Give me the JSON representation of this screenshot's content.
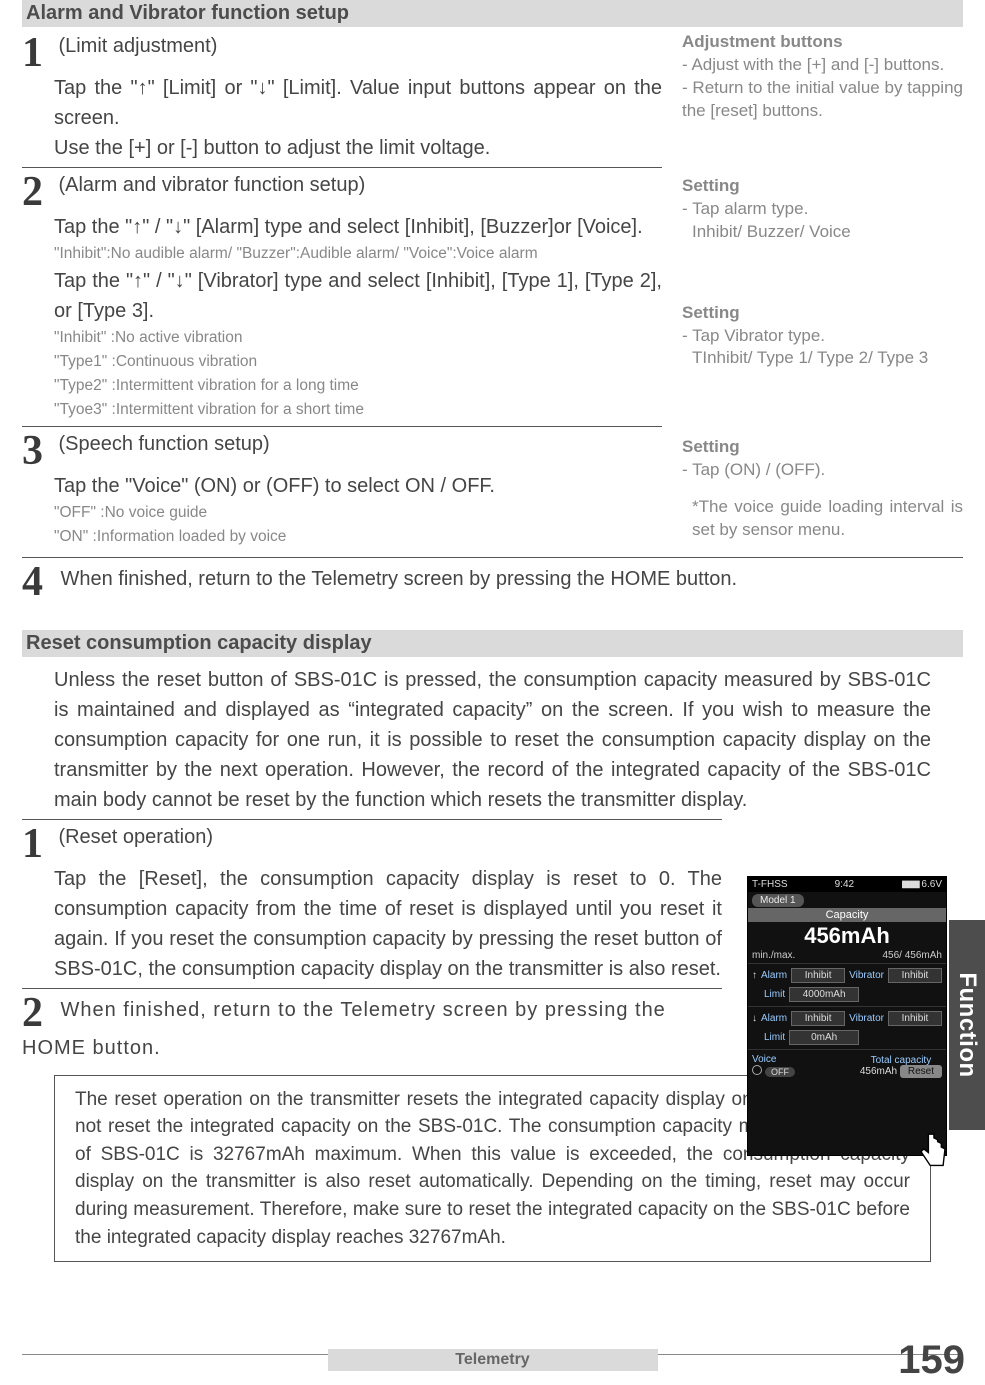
{
  "header1": "Alarm and Vibrator function setup",
  "step1": {
    "num": "1",
    "title": "(Limit adjustment)",
    "body1": "Tap the \"↑\" [Limit] or \"↓\" [Limit].  Value input buttons appear on the screen.",
    "body2": "Use the [+] or [-] button to adjust the limit voltage."
  },
  "side1": {
    "h": "Adjustment buttons",
    "l1": "- Adjust with the [+] and [-] buttons.",
    "l2": "- Return to the initial value by tapping the [reset] buttons."
  },
  "step2": {
    "num": "2",
    "title": "(Alarm and vibrator function setup)",
    "body1": "Tap the \"↑\" / \"↓\" [Alarm]  type and select [Inhibit], [Buzzer]or [Voice].",
    "note1": "\"Inhibit\":No audible alarm/ \"Buzzer\":Audible alarm/ \"Voice\":Voice alarm",
    "body2": "Tap the \"↑\" / \"↓\" [Vibrator]  type and select [Inhibit],  [Type 1],  [Type 2], or [Type 3].",
    "note2a": "\"Inhibit\"  :No active vibration",
    "note2b": "\"Type1\"  :Continuous vibration",
    "note2c": "\"Type2\"  :Intermittent vibration for a long time",
    "note2d": "\"Tyoe3\"  :Intermittent vibration for a short time"
  },
  "side2": {
    "h": "Setting",
    "l1": "- Tap alarm type.",
    "l2": "Inhibit/ Buzzer/ Voice"
  },
  "side3": {
    "h": "Setting",
    "l1": "- Tap Vibrator type.",
    "l2": "TInhibit/ Type 1/ Type 2/ Type 3"
  },
  "step3": {
    "num": "3",
    "title": "(Speech function setup)",
    "body1": "Tap the \"Voice\" (ON) or (OFF) to select ON / OFF.",
    "note1": "\"OFF\" :No voice guide",
    "note2": "\"ON\"  :Information loaded by voice"
  },
  "side4": {
    "h": "Setting",
    "l1": "- Tap (ON) / (OFF).",
    "l2": "*The voice guide loading interval is set by sensor menu."
  },
  "step4": {
    "num": "4",
    "body1": "When finished, return to the Telemetry screen by pressing the HOME button."
  },
  "header2": "Reset consumption capacity display",
  "para1": "Unless the reset button of SBS-01C is pressed, the consumption capacity measured by SBS-01C is maintained and displayed as “integrated capacity” on the screen. If you wish to measure the consumption capacity for one run, it is possible to reset the consumption capacity display on the transmitter by the next operation. However, the record of the integrated capacity of the SBS-01C main body cannot be reset by the function which resets the transmitter display.",
  "stepR1": {
    "num": "1",
    "title": "(Reset operation)",
    "body1": "Tap the [Reset], the consumption capacity display is reset to 0. The consumption capacity from the time of reset is displayed until you reset it again. If you reset the consumption capacity by pressing the reset button of SBS-01C, the consumption capacity display on the transmitter is also reset."
  },
  "stepR2": {
    "num": "2",
    "body1": "When finished, return to the Telemetry screen by pressing the HOME button."
  },
  "notebox": "The reset operation on the transmitter resets the integrated capacity display on the T7PX. It does not reset the integrated capacity on the SBS-01C. The consumption capacity measurement range of SBS-01C is 32767mAh maximum. When this value is exceeded, the consumption capacity display on the transmitter is also reset automatically. Depending on the timing, reset may occur during measurement. Therefore, make sure to reset the integrated capacity on the SBS-01C before the integrated capacity display reaches 32767mAh.",
  "footer": "Telemetry",
  "pagenum": "159",
  "sidetab": "Function",
  "thumb": {
    "sys": "T-FHSS",
    "time": "9:42",
    "batt": "6.6V",
    "model": "Model 1",
    "captitle": "Capacity",
    "capval": "456mAh",
    "minmax_l": "min./max.",
    "minmax_r": "456/  456mAh",
    "alarm": "Alarm",
    "vibrator": "Vibrator",
    "inhibit": "Inhibit",
    "limit": "Limit",
    "limit_u": "4000mAh",
    "limit_d": "0mAh",
    "voice": "Voice",
    "off": "OFF",
    "totcap": "Total capacity",
    "totval": "456mAh",
    "reset": "Reset"
  }
}
